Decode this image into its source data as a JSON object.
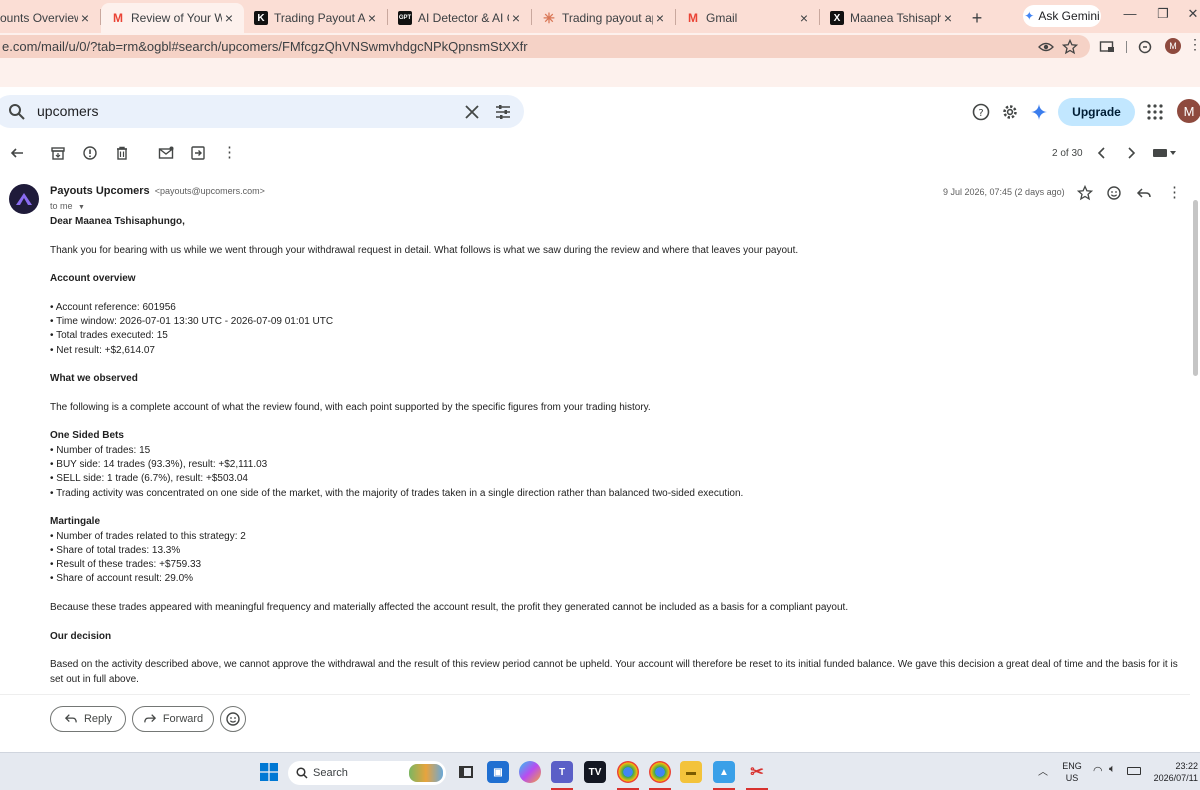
{
  "browser": {
    "tabs": [
      {
        "title": "ounts Overview | Up",
        "active": false,
        "favicon": "document-icon"
      },
      {
        "title": "Review of Your Withdra",
        "active": true,
        "favicon": "gmail-icon"
      },
      {
        "title": "Trading Payout Appeal",
        "active": false,
        "favicon": "k-logo-icon"
      },
      {
        "title": "AI Detector & AI Check",
        "active": false,
        "favicon": "zerogpt-icon"
      },
      {
        "title": "Trading payout appeal",
        "active": false,
        "favicon": "claude-icon"
      },
      {
        "title": "Gmail",
        "active": false,
        "favicon": "gmail-icon"
      },
      {
        "title": "Maanea Tshisaphungo",
        "active": false,
        "favicon": "x-logo-icon"
      }
    ],
    "new_tab": "+",
    "ask_gemini": "Ask Gemini",
    "url": "e.com/mail/u/0/?tab=rm&ogbl#search/upcomers/FMfcgzQhVNSwmvhdgcNPkQpnsmStXXfr",
    "profile_initial": "M"
  },
  "gmail": {
    "search_query": "upcomers",
    "upgrade_label": "Upgrade",
    "avatar_initial": "M",
    "pagination": "2 of 30"
  },
  "email": {
    "sender_name": "Payouts Upcomers",
    "sender_email": "<payouts@upcomers.com>",
    "to": "to me",
    "datetime": "9 Jul 2026, 07:45 (2 days ago)",
    "body": [
      {
        "text": "Dear Maanea Tshisaphungo,",
        "bold": true
      },
      {
        "text": "",
        "bold": false
      },
      {
        "text": "Thank you for bearing with us while we went through your withdrawal request in detail. What follows is what we saw during the review and where that leaves your payout.",
        "bold": false
      },
      {
        "text": "",
        "bold": false
      },
      {
        "text": "Account overview",
        "bold": true
      },
      {
        "text": "",
        "bold": false
      },
      {
        "text": "• Account reference: 601956",
        "bold": false
      },
      {
        "text": "• Time window: 2026-07-01 13:30 UTC - 2026-07-09 01:01 UTC",
        "bold": false
      },
      {
        "text": "• Total trades executed: 15",
        "bold": false
      },
      {
        "text": "• Net result: +$2,614.07",
        "bold": false
      },
      {
        "text": "",
        "bold": false
      },
      {
        "text": "What we observed",
        "bold": true
      },
      {
        "text": "",
        "bold": false
      },
      {
        "text": "The following is a complete account of what the review found, with each point supported by the specific figures from your trading history.",
        "bold": false
      },
      {
        "text": "",
        "bold": false
      },
      {
        "text": "One Sided Bets",
        "bold": true
      },
      {
        "text": "• Number of trades: 15",
        "bold": false
      },
      {
        "text": "• BUY side: 14 trades (93.3%), result: +$2,111.03",
        "bold": false
      },
      {
        "text": "• SELL side: 1 trade (6.7%), result: +$503.04",
        "bold": false
      },
      {
        "text": "• Trading activity was concentrated on one side of the market, with the majority of trades taken in a single direction rather than balanced two-sided execution.",
        "bold": false
      },
      {
        "text": "",
        "bold": false
      },
      {
        "text": "Martingale",
        "bold": true
      },
      {
        "text": "• Number of trades related to this strategy: 2",
        "bold": false
      },
      {
        "text": "• Share of total trades: 13.3%",
        "bold": false
      },
      {
        "text": "• Result of these trades: +$759.33",
        "bold": false
      },
      {
        "text": "• Share of account result: 29.0%",
        "bold": false
      },
      {
        "text": "",
        "bold": false
      },
      {
        "text": "Because these trades appeared with meaningful frequency and materially affected the account result, the profit they generated cannot be included as a basis for a compliant payout.",
        "bold": false
      },
      {
        "text": "",
        "bold": false
      },
      {
        "text": "Our decision",
        "bold": true
      },
      {
        "text": "",
        "bold": false
      },
      {
        "text": "Based on the activity described above, we cannot approve the withdrawal and the result of this review period cannot be upheld. Your account will therefore be reset to its initial funded balance. We gave this decision a great deal of time and the basis for it is set out in full above.",
        "bold": false
      }
    ],
    "reply_label": "Reply",
    "forward_label": "Forward"
  },
  "taskbar": {
    "search_label": "Search",
    "lang_line1": "ENG",
    "lang_line2": "US",
    "time": "23:22",
    "date": "2026/07/11"
  },
  "colors": {
    "tab_strip": "#fbded5",
    "address_bar": "#fdf1ed",
    "search_bg": "#eaf1fb",
    "upgrade_bg": "#c2e7ff",
    "gmail_red": "#ea4335"
  }
}
